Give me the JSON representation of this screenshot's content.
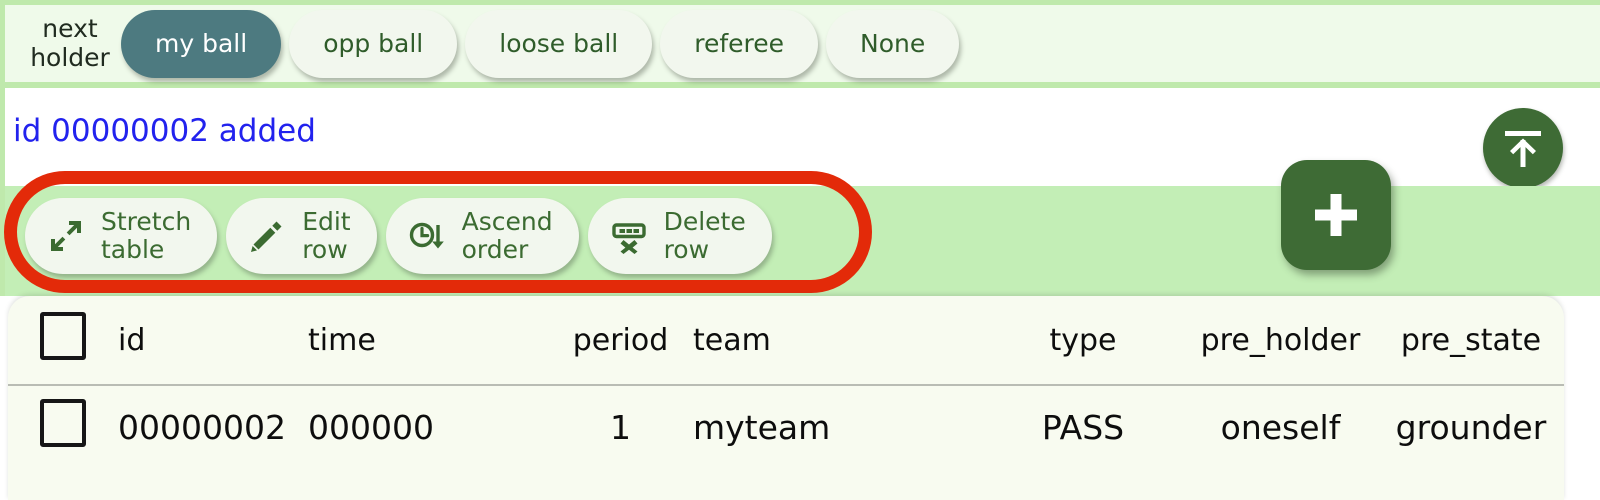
{
  "selector": {
    "label": "next\nholder",
    "options": [
      {
        "label": "my ball",
        "selected": true
      },
      {
        "label": "opp ball",
        "selected": false
      },
      {
        "label": "loose ball",
        "selected": false
      },
      {
        "label": "referee",
        "selected": false
      },
      {
        "label": "None",
        "selected": false
      }
    ],
    "colors": {
      "selected_bg": "#4d7a80",
      "chip_bg": "#f2f7ee",
      "chip_text": "#2f5c2a",
      "band_bg": "#effaea",
      "band_border": "#bfe9ac"
    }
  },
  "status": {
    "message": "id 00000002 added",
    "message_color": "#2222ee",
    "upload_icon": "upload-to-top-icon"
  },
  "toolbar": {
    "band_color": "#c3eeb6",
    "buttons": [
      {
        "icon": "expand-diagonal-icon",
        "label": "Stretch\ntable"
      },
      {
        "icon": "pencil-icon",
        "label": "Edit\nrow"
      },
      {
        "icon": "clock-arrow-down-icon",
        "label": "Ascend\norder"
      },
      {
        "icon": "row-delete-icon",
        "label": "Delete\nrow"
      }
    ],
    "add_button": {
      "icon": "plus-icon",
      "label": "+"
    },
    "annotation": {
      "shape": "rounded-rectangle-outline",
      "color": "#e32a09"
    }
  },
  "table": {
    "select_all_checkbox": "unchecked",
    "columns": [
      "id",
      "time",
      "period",
      "team",
      "type",
      "pre_holder",
      "pre_state"
    ],
    "rows": [
      {
        "checkbox": "unchecked",
        "id": "00000002",
        "time": "000000",
        "period": "1",
        "team": "myteam",
        "type": "PASS",
        "pre_holder": "oneself",
        "pre_state": "grounder"
      }
    ]
  }
}
